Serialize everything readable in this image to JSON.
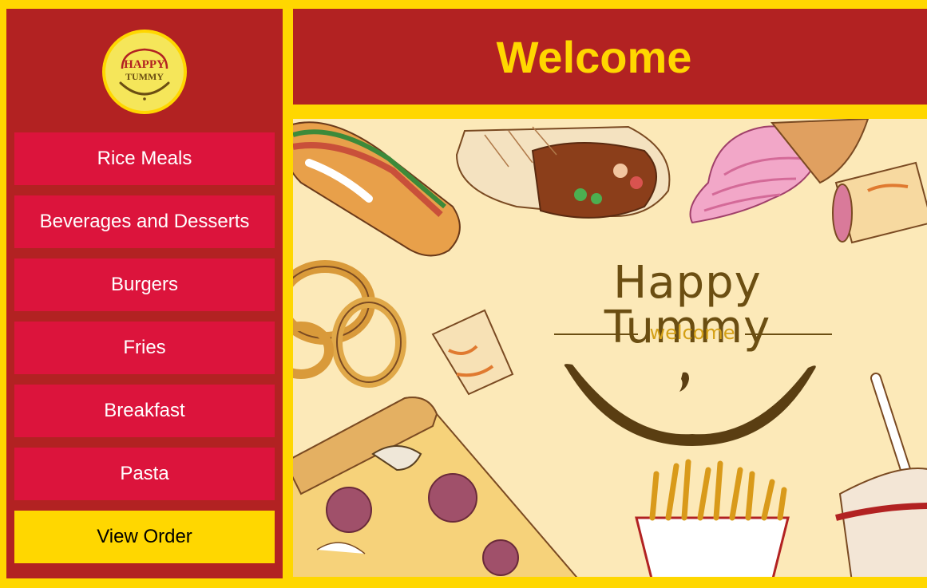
{
  "app": {
    "window_title": "Happy Tummy"
  },
  "sidebar": {
    "logo_text_top": "HAPPY",
    "logo_text_bottom": "TUMMY",
    "menu": [
      {
        "label": "Rice Meals"
      },
      {
        "label": "Beverages and Desserts"
      },
      {
        "label": "Burgers"
      },
      {
        "label": "Fries"
      },
      {
        "label": "Breakfast"
      },
      {
        "label": "Pasta"
      }
    ],
    "order_button": "View Order"
  },
  "header": {
    "title": "Welcome"
  },
  "hero": {
    "brand_title": "Happy Tummy",
    "brand_subtitle": "welcome",
    "illustrations": [
      "hotdog",
      "burrito",
      "ice-cream-cone",
      "eggroll",
      "onion-rings",
      "pizza-slice",
      "french-fries",
      "soda-cup"
    ]
  },
  "colors": {
    "background": "#FFD700",
    "panel_red": "#B22222",
    "button_crimson": "#DC143C",
    "accent_yellow": "#FFD700",
    "hero_cream": "#FCE9B8",
    "brand_brown": "#6B4E12"
  }
}
